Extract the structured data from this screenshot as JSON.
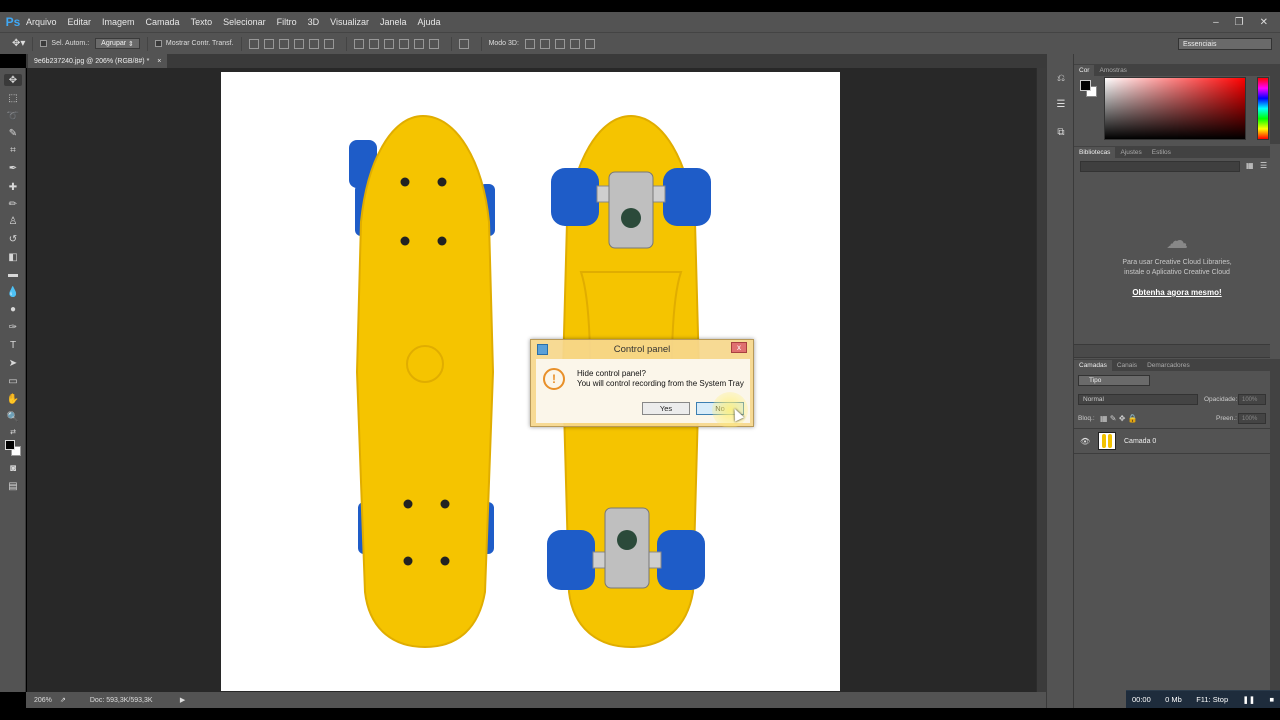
{
  "app": {
    "logo": "Ps"
  },
  "menu": [
    "Arquivo",
    "Editar",
    "Imagem",
    "Camada",
    "Texto",
    "Selecionar",
    "Filtro",
    "3D",
    "Visualizar",
    "Janela",
    "Ajuda"
  ],
  "window_controls": [
    "–",
    "❐",
    "✕"
  ],
  "options_bar": {
    "auto_select_label": "Sel. Autom.:",
    "auto_select_value": "Agrupar",
    "transform_label": "Mostrar Contr. Transf.",
    "mode3d_label": "Modo 3D:",
    "workspace": "Essenciais"
  },
  "document_tab": {
    "title": "9e6b237240.jpg @ 206% (RGB/8#) *",
    "close": "×"
  },
  "status_bar": {
    "zoom": "206%",
    "doc_size": "Doc: 593,3K/593,3K"
  },
  "color_panel": {
    "tabs": [
      "Cor",
      "Amostras"
    ],
    "fg": "#000000",
    "bg": "#ffffff",
    "hue": "#ff0000"
  },
  "libraries_panel": {
    "tabs": [
      "Bibliotecas",
      "Ajustes",
      "Estilos"
    ],
    "message_line1": "Para usar Creative Cloud Libraries,",
    "message_line2": "instale o Aplicativo Creative Cloud",
    "link": "Obtenha agora mesmo!"
  },
  "layers_panel": {
    "tabs": [
      "Camadas",
      "Canais",
      "Demarcadores"
    ],
    "filter": "Tipo",
    "blend_mode": "Normal",
    "opacity_label": "Opacidade:",
    "opacity_value": "100%",
    "lock_label": "Bloq.:",
    "fill_label": "Preen.:",
    "fill_value": "100%",
    "layer_name": "Camada 0"
  },
  "recorder_bar": {
    "time": "00:00",
    "size": "0 Mb",
    "stop": "F11: Stop"
  },
  "dialog": {
    "title": "Control panel",
    "close": "x",
    "heading": "Hide control panel?",
    "message": "You will control recording from the System Tray",
    "yes": "Yes",
    "no": "No"
  },
  "colors": {
    "skateboard": "#f5c400",
    "wheel": "#1e5cc8",
    "ps_blue": "#3fa8f5"
  }
}
